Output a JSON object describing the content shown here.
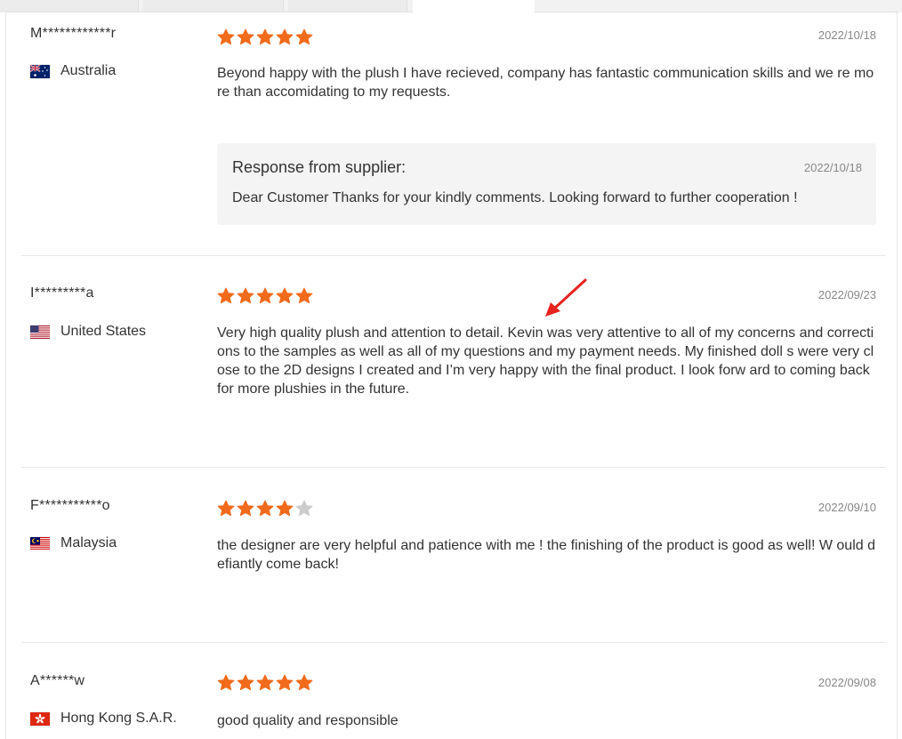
{
  "colors": {
    "star_filled": "#f26a1b",
    "star_empty": "#cccccc",
    "annotation_arrow": "#e8231f",
    "response_bg": "#f4f4f4"
  },
  "reviews": [
    {
      "reviewer": "M************r",
      "country": "Australia",
      "flag_icon": "flag-australia-icon",
      "rating": 5,
      "date": "2022/10/18",
      "text": "Beyond happy with the plush I have recieved, company has fantastic communication skills and we re more than accomidating to my requests.",
      "response": {
        "title": "Response from supplier:",
        "date": "2022/10/18",
        "text": "Dear Customer Thanks for your kindly comments. Looking forward to further cooperation !"
      }
    },
    {
      "reviewer": "I*********a",
      "country": "United States",
      "flag_icon": "flag-united-states-icon",
      "rating": 5,
      "date": "2022/09/23",
      "text": "Very high quality plush and attention to detail. Kevin was very attentive to all of my concerns and corrections to the samples as well as all of my questions and my payment needs. My finished doll s were very close to the 2D designs I created and I’m very happy with the final product. I look forw ard to coming back for more plushies in the future."
    },
    {
      "reviewer": "F***********o",
      "country": "Malaysia",
      "flag_icon": "flag-malaysia-icon",
      "rating": 4,
      "date": "2022/09/10",
      "text": "the designer are very helpful and patience with me ! the finishing of the product is good as well! W ould defiantly come back!"
    },
    {
      "reviewer": "A******w",
      "country": "Hong Kong S.A.R.",
      "flag_icon": "flag-hong-kong-icon",
      "rating": 5,
      "date": "2022/09/08",
      "text": "good quality and responsible"
    }
  ],
  "annotation": {
    "icon": "red-arrow-icon"
  }
}
